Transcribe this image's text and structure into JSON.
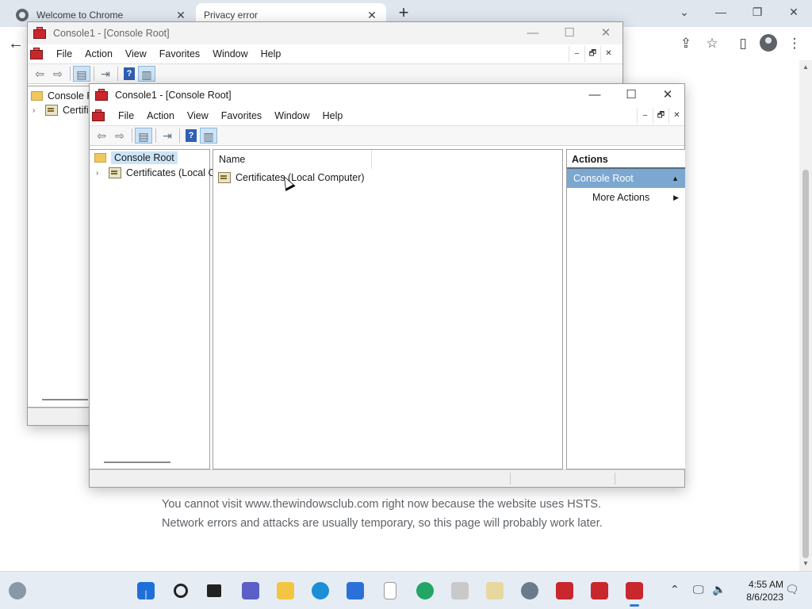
{
  "browser": {
    "tabs": [
      {
        "title": "Welcome to Chrome",
        "close": "✕"
      },
      {
        "title": "Privacy error",
        "close": "✕"
      }
    ],
    "new_tab": "+",
    "window_controls": {
      "minimize": "—",
      "maximize": "❐",
      "close": "✕",
      "tab_search": "⌄"
    },
    "toolbar_icons": {
      "back": "←",
      "share": "⇪",
      "bookmark": "☆",
      "side_panel": "▯",
      "menu": "⋮"
    },
    "page_message": [
      "You cannot visit www.thewindowsclub.com right now because the website uses HSTS.",
      "Network errors and attacks are usually temporary, so this page will probably work later."
    ],
    "scroll_arrows": {
      "up": "▲",
      "down": "▼"
    }
  },
  "mmc_back": {
    "title": "Console1 - [Console Root]",
    "menu": [
      "File",
      "Action",
      "View",
      "Favorites",
      "Window",
      "Help"
    ],
    "mdi_controls": [
      "–",
      "🗗",
      "✕"
    ],
    "window_controls": {
      "minimize": "—",
      "maximize": "☐",
      "close": "✕"
    },
    "tree": [
      {
        "label": "Console R"
      },
      {
        "label": "Certifi",
        "expander": "›"
      }
    ]
  },
  "mmc_front": {
    "title": "Console1 - [Console Root]",
    "menu": [
      "File",
      "Action",
      "View",
      "Favorites",
      "Window",
      "Help"
    ],
    "mdi_controls": [
      "–",
      "🗗",
      "✕"
    ],
    "window_controls": {
      "minimize": "—",
      "maximize": "☐",
      "close": "✕"
    },
    "toolbar": {
      "back": "⇦",
      "forward": "⇨",
      "help": "?"
    },
    "tree": [
      {
        "label": "Console Root",
        "selected": true
      },
      {
        "label": "Certificates (Local C",
        "expander": "›"
      }
    ],
    "list": {
      "column_header": "Name",
      "items": [
        "Certificates (Local Computer)"
      ]
    },
    "actions": {
      "title": "Actions",
      "group": "Console Root",
      "group_arrow": "▲",
      "items": [
        {
          "label": "More Actions",
          "arrow": "▶"
        }
      ]
    }
  },
  "taskbar": {
    "tray_icons": {
      "chevron": "⌃",
      "network": "🖵",
      "volume": "🔈",
      "notifications": "🗨"
    },
    "clock": {
      "time": "4:55 AM",
      "date": "8/6/2023"
    }
  },
  "colors": {
    "titlebar_bg": "#dfe6ee",
    "selection": "#cce4f7",
    "actions_header": "#7ba7d0",
    "accent": "#3178d6"
  }
}
